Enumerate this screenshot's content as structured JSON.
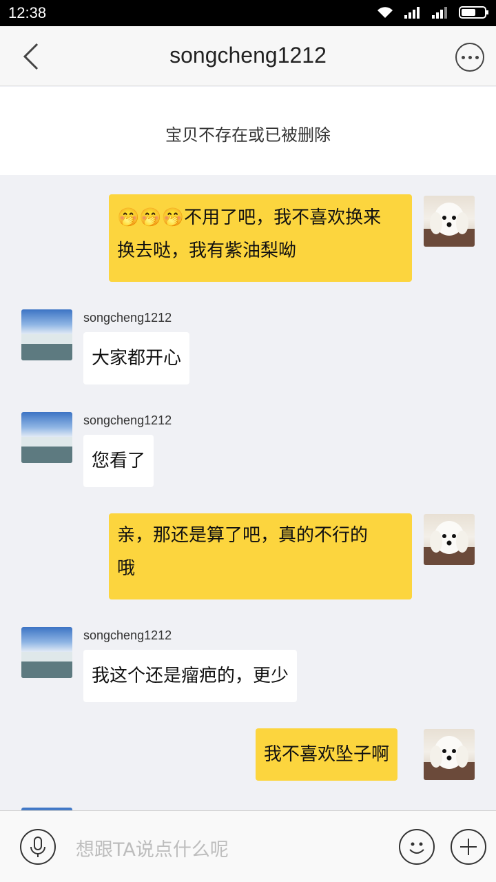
{
  "status_bar": {
    "time": "12:38"
  },
  "nav": {
    "title": "songcheng1212"
  },
  "notice": {
    "text": "宝贝不存在或已被删除"
  },
  "messages": [
    {
      "from": "me",
      "text_line1": "🤭🤭🤭不用了吧，我不喜欢换来",
      "text_line2": "换去哒，我有紫油梨呦"
    },
    {
      "from": "other",
      "sender": "songcheng1212",
      "text": "大家都开心"
    },
    {
      "from": "other",
      "sender": "songcheng1212",
      "text": "您看了"
    },
    {
      "from": "me",
      "text_line1": "亲，那还是算了吧，真的不行的",
      "text_line2": "哦"
    },
    {
      "from": "other",
      "sender": "songcheng1212",
      "text": "我这个还是瘤疤的，更少"
    },
    {
      "from": "me",
      "text": "我不喜欢坠子啊"
    }
  ],
  "input": {
    "placeholder": "想跟TA说点什么呢"
  },
  "colors": {
    "my_bubble": "#fcd53e",
    "their_bubble": "#ffffff",
    "chat_bg": "#f0f1f5"
  }
}
